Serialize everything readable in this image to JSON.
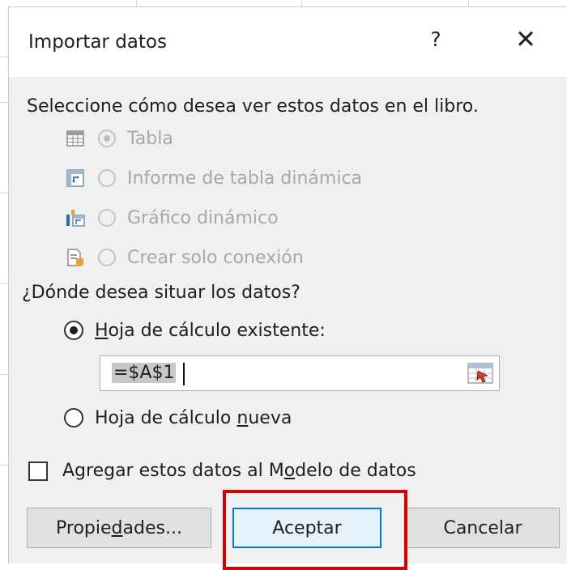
{
  "dialog": {
    "title": "Importar datos",
    "help_label": "?",
    "close_label": "✕"
  },
  "view": {
    "heading": "Seleccione cómo desea ver estos datos en el libro.",
    "options": [
      {
        "label": "Tabla",
        "icon": "table-icon",
        "selected": true,
        "enabled": false
      },
      {
        "label": "Informe de tabla dinámica",
        "icon": "pivot-table-icon",
        "selected": false,
        "enabled": false
      },
      {
        "label": "Gráfico dinámico",
        "icon": "pivot-chart-icon",
        "selected": false,
        "enabled": false
      },
      {
        "label": "Crear solo conexión",
        "icon": "connection-icon",
        "selected": false,
        "enabled": false
      }
    ]
  },
  "location": {
    "heading": "¿Dónde desea situar los datos?",
    "existing": {
      "before": "",
      "underlined": "H",
      "after": "oja de cálculo existente:",
      "selected": true
    },
    "range_value": "=$A$1",
    "new_sheet": {
      "before": "Hoja de cálculo ",
      "underlined": "n",
      "after": "ueva",
      "selected": false
    }
  },
  "data_model": {
    "before": "Agregar estos datos al M",
    "underlined": "o",
    "after": "delo de datos",
    "checked": false
  },
  "buttons": {
    "properties": {
      "before": "Propie",
      "underlined": "d",
      "after": "ades..."
    },
    "ok": "Aceptar",
    "cancel": "Cancelar"
  },
  "colors": {
    "highlight": "#d60000",
    "primary_border": "#0078d7",
    "dialog_bg": "#f0f0f0"
  }
}
